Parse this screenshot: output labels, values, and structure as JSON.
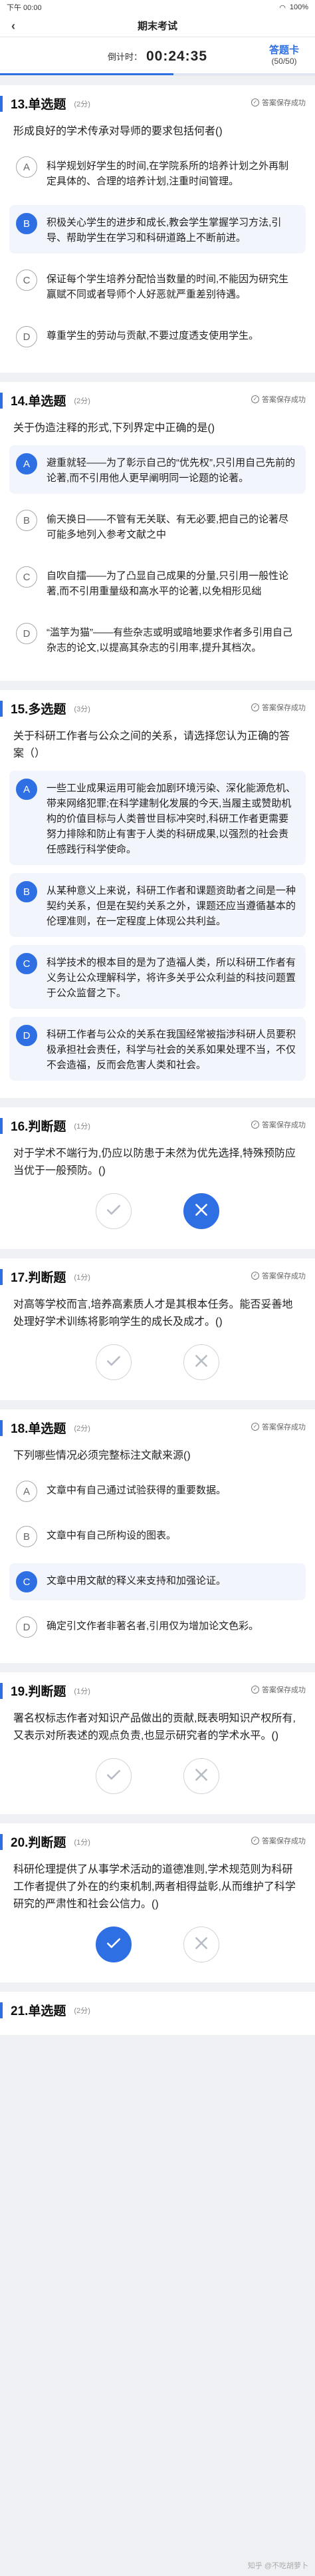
{
  "status": {
    "time": "下午 00:00",
    "battery": "100%"
  },
  "header": {
    "title": "期末考试"
  },
  "timer": {
    "label": "倒计时：",
    "value": "00:24:35",
    "progress": 0.55
  },
  "answer_card": {
    "title": "答题卡",
    "count": "(50/50)"
  },
  "saved_text": "答案保存成功",
  "questions": [
    {
      "num": "13.单选题",
      "score": "(2分)",
      "text": "形成良好的学术传承对导师的要求包括何者()",
      "options": [
        {
          "letter": "A",
          "text": "科学规划好学生的时间,在学院系所的培养计划之外再制定具体的、合理的培养计划,注重时间管理。",
          "selected": false
        },
        {
          "letter": "B",
          "text": "积极关心学生的进步和成长,教会学生掌握学习方法,引导、帮助学生在学习和科研道路上不断前进。",
          "selected": true
        },
        {
          "letter": "C",
          "text": "保证每个学生培养分配恰当数量的时间,不能因为研究生赢赋不同或者导师个人好恶就严重差别待遇。",
          "selected": false
        },
        {
          "letter": "D",
          "text": "尊重学生的劳动与贡献,不要过度透支使用学生。",
          "selected": false
        }
      ]
    },
    {
      "num": "14.单选题",
      "score": "(2分)",
      "text": "关于伪造注释的形式,下列界定中正确的是()",
      "options": [
        {
          "letter": "A",
          "text": "避重就轻——为了彰示自己的“优先权”,只引用自己先前的论著,而不引用他人更早阐明同一论题的论著。",
          "selected": true
        },
        {
          "letter": "B",
          "text": "偷天换日——不管有无关联、有无必要,把自己的论著尽可能多地列入参考文献之中",
          "selected": false
        },
        {
          "letter": "C",
          "text": "自吹自擂——为了凸显自己成果的分量,只引用一般性论著,而不引用重量级和高水平的论著,以免相形见绌",
          "selected": false
        },
        {
          "letter": "D",
          "text": "“滥竽为猫”——有些杂志或明或暗地要求作者多引用自己杂志的论文,以提高其杂志的引用率,提升其档次。",
          "selected": false
        }
      ]
    },
    {
      "num": "15.多选题",
      "score": "(3分)",
      "text": "关于科研工作者与公众之间的关系，请选择您认为正确的答案（）",
      "options": [
        {
          "letter": "A",
          "text": "一些工业成果运用可能会加剧环境污染、深化能源危机、带来网络犯罪;在科学建制化发展的今天,当履主或赞助机构的价值目标与人类普世目标冲突时,科研工作者更需要努力排除和防止有害于人类的科研成果,以强烈的社会责任感践行科学使命。",
          "selected": true
        },
        {
          "letter": "B",
          "text": "从某种意义上来说，科研工作者和课题资助者之间是一种契约关系，但是在契约关系之外，课题还应当遵循基本的伦理准则，在一定程度上体现公共利益。",
          "selected": true
        },
        {
          "letter": "C",
          "text": "科学技术的根本目的是为了造福人类，所以科研工作者有义务让公众理解科学，将许多关乎公众利益的科技问题置于公众监督之下。",
          "selected": true
        },
        {
          "letter": "D",
          "text": "科研工作者与公众的关系在我国经常被指涉科研人员要积极承担社会责任，科学与社会的关系如果处理不当，不仅不会造福，反而会危害人类和社会。",
          "selected": true
        }
      ]
    },
    {
      "num": "16.判断题",
      "score": "(1分)",
      "text": "对于学术不端行为,仍应以防患于未然为优先选择,特殊预防应当优于一般预防。()",
      "judge": "false"
    },
    {
      "num": "17.判断题",
      "score": "(1分)",
      "text": "对高等学校而言,培养高素质人才是其根本任务。能否妥善地处理好学术训练将影响学生的成长及成才。()",
      "judge": "none"
    },
    {
      "num": "18.单选题",
      "score": "(2分)",
      "text": "下列哪些情况必须完整标注文献来源()",
      "options": [
        {
          "letter": "A",
          "text": "文章中有自己通过试验获得的重要数据。",
          "selected": false
        },
        {
          "letter": "B",
          "text": "文章中有自己所构设的图表。",
          "selected": false
        },
        {
          "letter": "C",
          "text": "文章中用文献的释义来支持和加强论证。",
          "selected": true
        },
        {
          "letter": "D",
          "text": "确定引文作者非著名者,引用仅为增加论文色彩。",
          "selected": false
        }
      ]
    },
    {
      "num": "19.判断题",
      "score": "(1分)",
      "text": "署名权标志作者对知识产品做出的贡献,既表明知识产权所有,又表示对所表述的观点负责,也显示研究者的学术水平。()",
      "judge": "none"
    },
    {
      "num": "20.判断题",
      "score": "(1分)",
      "text": "科研伦理提供了从事学术活动的道德准则,学术规范则为科研工作者提供了外在的约束机制,两者相得益彰,从而维护了科学研究的严肃性和社会公信力。()",
      "judge": "true"
    },
    {
      "num": "21.单选题",
      "score": "(2分)",
      "text": "",
      "options": []
    }
  ],
  "watermark": "知乎 @不吃胡萝卜"
}
